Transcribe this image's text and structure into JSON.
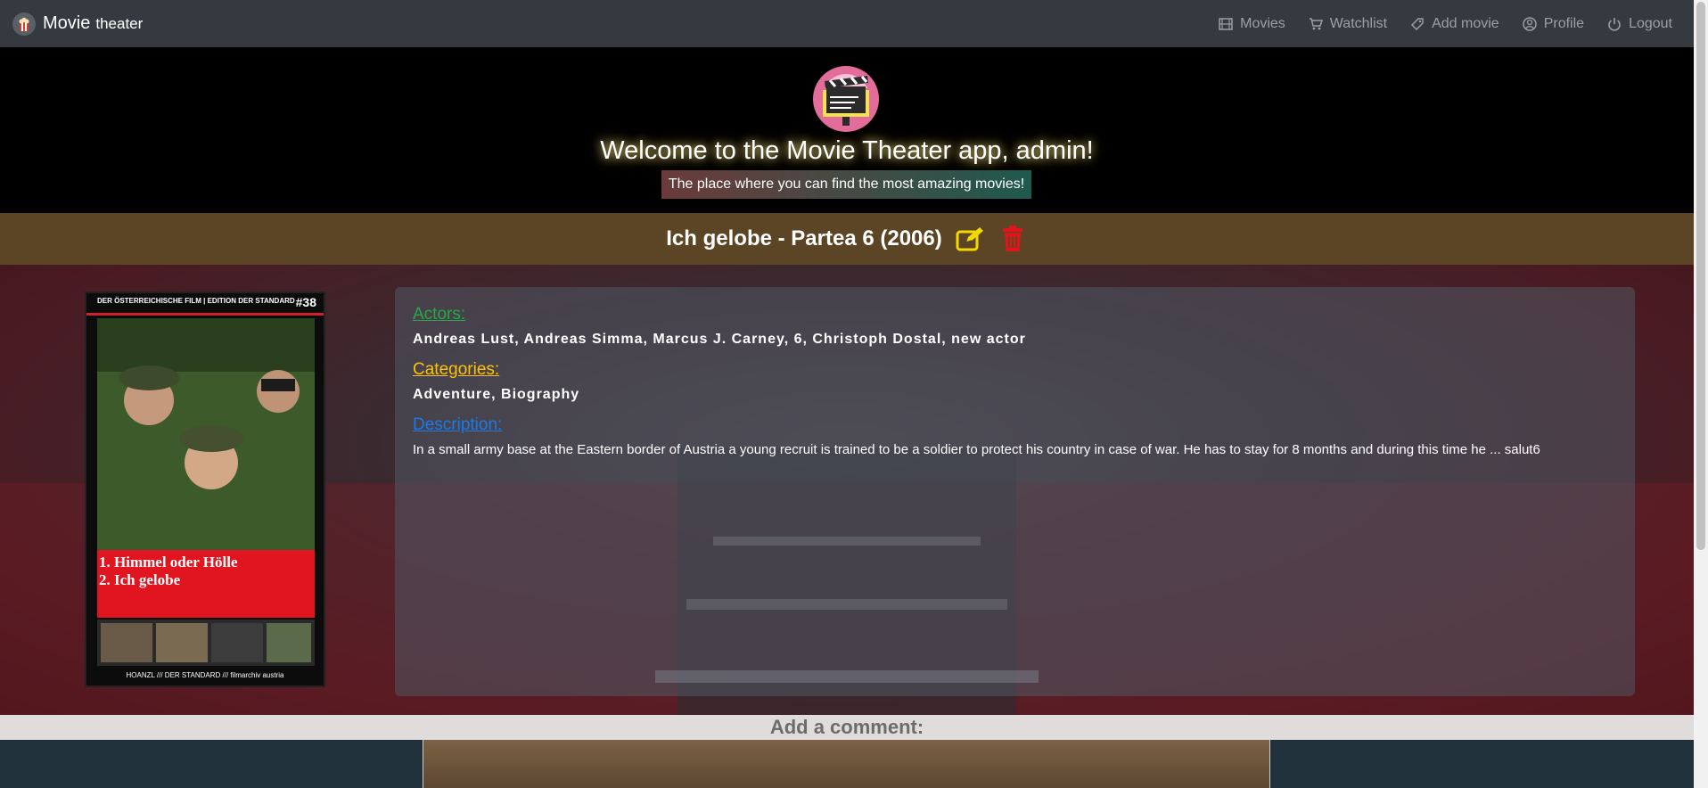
{
  "navbar": {
    "brand_title": "Movie",
    "brand_sub": "theater",
    "links": [
      {
        "label": "Movies",
        "icon": "film-icon"
      },
      {
        "label": "Watchlist",
        "icon": "cart-icon"
      },
      {
        "label": "Add movie",
        "icon": "tag-icon"
      },
      {
        "label": "Profile",
        "icon": "user-circle-icon"
      },
      {
        "label": "Logout",
        "icon": "power-icon"
      }
    ]
  },
  "hero": {
    "title": "Welcome to the Movie Theater app, admin!",
    "subtitle": "The place where you can find the most amazing movies!"
  },
  "movie": {
    "title": "Ich gelobe - Partea 6 (2006)",
    "actors_label": "Actors:",
    "actors": "Andreas Lust, Andreas Simma, Marcus J. Carney, 6, Christoph Dostal, new actor",
    "categories_label": "Categories:",
    "categories": "Adventure, Biography",
    "description_label": "Description:",
    "description": "In a small army base at the Eastern border of Austria a young recruit is trained to be a soldier to protect his country in case of war. He has to stay for 8 months and during this time he ... salut6"
  },
  "poster": {
    "header_left": "DER ÖSTERREICHISCHE FILM | EDITION DER STANDARD",
    "number": "#38",
    "line1": "1. Himmel oder Hölle",
    "line2": "2. Ich gelobe",
    "footer": "HOANZL /// DER STANDARD /// filmarchiv austria"
  },
  "comments": {
    "title": "Add a comment:"
  },
  "colors": {
    "navbar": "#343a40",
    "title_bar": "#5b4524",
    "actors": "#28a745",
    "categories": "#ffc107",
    "description": "#1a7ae8",
    "edit_icon": "#f5d800",
    "delete_icon": "#e0151b"
  }
}
